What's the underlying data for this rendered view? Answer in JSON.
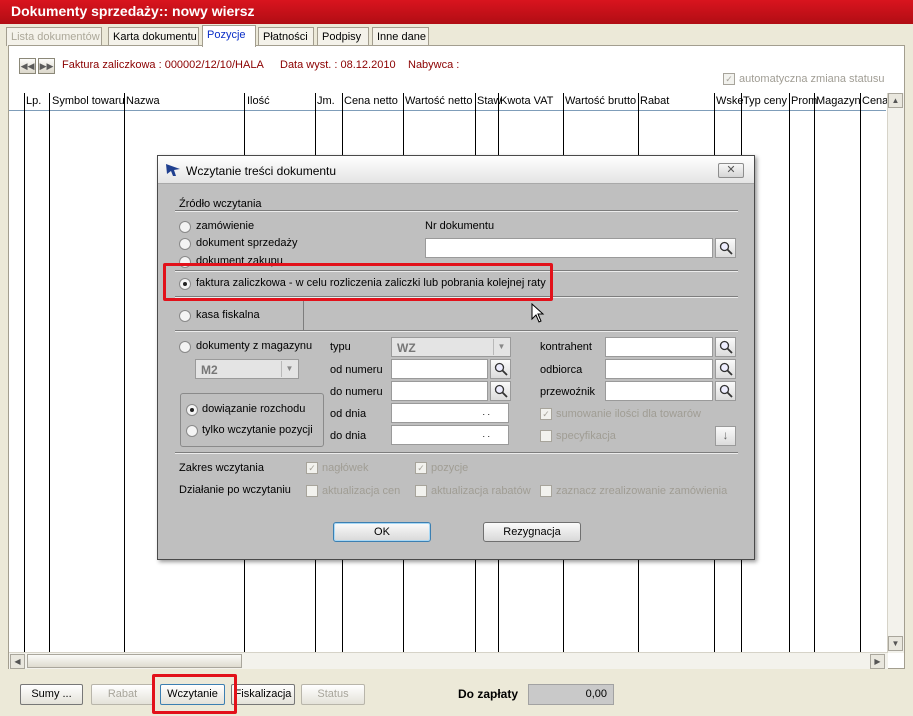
{
  "window": {
    "title": "Dokumenty sprzedaży:: nowy wiersz"
  },
  "tabs": [
    {
      "label": "Lista dokumentów",
      "state": "disabled"
    },
    {
      "label": "Karta dokumentu",
      "state": "normal"
    },
    {
      "label": "Pozycje",
      "state": "active"
    },
    {
      "label": "Płatności",
      "state": "normal"
    },
    {
      "label": "Podpisy",
      "state": "normal"
    },
    {
      "label": "Inne dane",
      "state": "normal"
    }
  ],
  "doc_header": {
    "prev_icon": "double-left-icon",
    "next_icon": "double-right-icon",
    "document": "Faktura zaliczkowa : 000002/12/10/HALA",
    "date": "Data wyst. : 08.12.2010",
    "buyer": "Nabywca :",
    "auto_status_label": "automatyczna zmiana statusu",
    "auto_status_checked": true
  },
  "grid": {
    "columns": [
      "Lp.",
      "Symbol towaru",
      "Nazwa",
      "Ilość",
      "Jm.",
      "Cena netto",
      "Wartość netto",
      "Staw",
      "Kwota VAT",
      "Wartość brutto",
      "Rabat",
      "Wske",
      "Typ ceny",
      "Prom",
      "Magazyn",
      "Cena"
    ]
  },
  "bottom": {
    "sumy": "Sumy ...",
    "rabat": "Rabat",
    "wczytanie": "Wczytanie",
    "fiskalizacja": "Fiskalizacja",
    "status": "Status",
    "do_zaplaty_label": "Do zapłaty",
    "do_zaplaty_value": "0,00"
  },
  "dialog": {
    "title": "Wczytanie treści dokumentu",
    "close_icon": "close-icon",
    "source_header": "Źródło wczytania",
    "sources": {
      "zamowienie": "zamówienie",
      "dok_sprzedazy": "dokument sprzedaży",
      "dok_zakupu": "dokument zakupu",
      "faktura_zaliczkowa": "faktura zaliczkowa - w celu rozliczenia zaliczki lub pobrania kolejnej raty",
      "kasa_fiskalna": "kasa fiskalna",
      "dok_z_magazynu": "dokumenty z magazynu"
    },
    "selected_source": "faktura_zaliczkowa",
    "nr_dokumentu_label": "Nr dokumentu",
    "nr_dokumentu_value": "",
    "magazyn_value": "M2",
    "typu_label": "typu",
    "typu_value": "WZ",
    "od_numeru_label": "od numeru",
    "do_numeru_label": "do numeru",
    "od_dnia_label": "od dnia",
    "do_dnia_label": "do dnia",
    "od_dnia_value": ". .",
    "do_dnia_value": ". .",
    "kontrahent_label": "kontrahent",
    "odbiorca_label": "odbiorca",
    "przewoznik_label": "przewoźnik",
    "sumowanie_label": "sumowanie ilości dla towarów",
    "sumowanie_checked": true,
    "specyfikacja_label": "specyfikacja",
    "specyfikacja_checked": false,
    "dowiazanie_label": "dowiązanie rozchodu",
    "tylko_label": "tylko wczytanie pozycji",
    "selected_mode": "dowiazanie",
    "zakres_label": "Zakres wczytania",
    "naglowek_label": "nagłówek",
    "naglowek_checked": true,
    "pozycje_label": "pozycje",
    "pozycje_checked": true,
    "dzialanie_label": "Działanie po wczytaniu",
    "aktualizacja_cen_label": "aktualizacja cen",
    "aktualizacja_rabatow_label": "aktualizacja rabatów",
    "zaznacz_label": "zaznacz zrealizowanie zamówienia",
    "ok_label": "OK",
    "rezygnacja_label": "Rezygnacja"
  },
  "colors": {
    "title_red": "#d9141e",
    "highlight_red": "#e2111a",
    "active_tab_text": "#0a2ec7",
    "doc_info_text": "#8b0000"
  }
}
